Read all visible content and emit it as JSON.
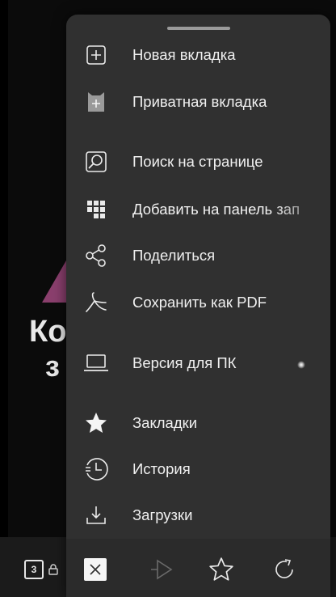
{
  "background": {
    "text_line1": "Ко",
    "text_line2": "з",
    "tab_count": "3"
  },
  "menu": {
    "items": [
      {
        "label": "Новая вкладка",
        "icon": "new-tab-plus-icon"
      },
      {
        "label": "Приватная вкладка",
        "icon": "private-tab-icon"
      },
      {
        "label": "Поиск на странице",
        "icon": "find-in-page-icon"
      },
      {
        "label": "Добавить на панель зап",
        "icon": "add-to-panel-grid-icon"
      },
      {
        "label": "Поделиться",
        "icon": "share-icon"
      },
      {
        "label": "Сохранить как PDF",
        "icon": "pdf-icon"
      },
      {
        "label": "Версия для ПК",
        "icon": "desktop-laptop-icon"
      },
      {
        "label": "Закладки",
        "icon": "bookmarks-star-icon"
      },
      {
        "label": "История",
        "icon": "history-clock-icon"
      },
      {
        "label": "Загрузки",
        "icon": "downloads-icon"
      }
    ]
  },
  "toolbar": {
    "buttons": [
      "close-icon",
      "forward-icon",
      "star-icon",
      "refresh-icon"
    ]
  },
  "colors": {
    "sheet": "#303030",
    "text": "#f0f0f0",
    "accent_private": "#9a9a9a"
  }
}
